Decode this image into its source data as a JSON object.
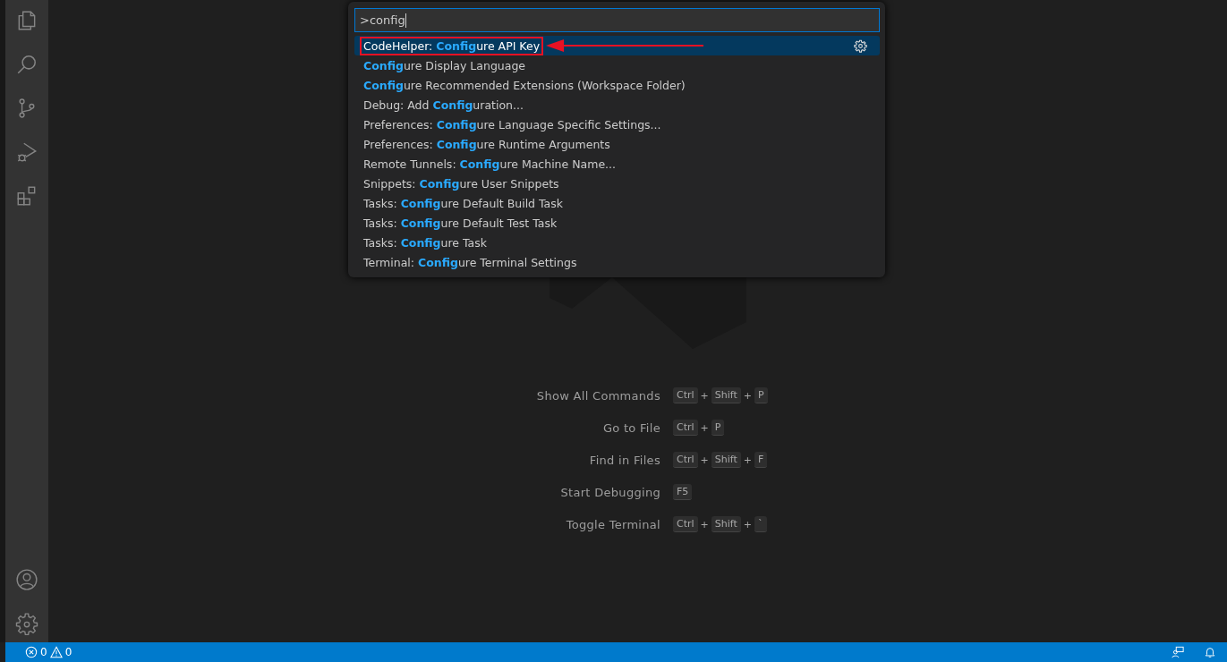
{
  "command_palette": {
    "query": ">config",
    "items": [
      {
        "label": "CodeHelper: **Config**ure API Key",
        "selected": true,
        "annotated": true
      },
      {
        "label": "**Config**ure Display Language",
        "selected": false,
        "annotated": false
      },
      {
        "label": "**Config**ure Recommended Extensions (Workspace Folder)",
        "selected": false,
        "annotated": false
      },
      {
        "label": "Debug: Add **Config**uration...",
        "selected": false,
        "annotated": false
      },
      {
        "label": "Preferences: **Config**ure Language Specific Settings...",
        "selected": false,
        "annotated": false
      },
      {
        "label": "Preferences: **Config**ure Runtime Arguments",
        "selected": false,
        "annotated": false
      },
      {
        "label": "Remote Tunnels: **Config**ure Machine Name...",
        "selected": false,
        "annotated": false
      },
      {
        "label": "Snippets: **Config**ure User Snippets",
        "selected": false,
        "annotated": false
      },
      {
        "label": "Tasks: **Config**ure Default Build Task",
        "selected": false,
        "annotated": false
      },
      {
        "label": "Tasks: **Config**ure Default Test Task",
        "selected": false,
        "annotated": false
      },
      {
        "label": "Tasks: **Config**ure Task",
        "selected": false,
        "annotated": false
      },
      {
        "label": "Terminal: **Config**ure Terminal Settings",
        "selected": false,
        "annotated": false
      }
    ]
  },
  "shortcuts": [
    {
      "label": "Show All Commands",
      "keys": [
        {
          "kind": "key",
          "text": "Ctrl"
        },
        {
          "kind": "plus",
          "text": "+"
        },
        {
          "kind": "key",
          "text": "Shift"
        },
        {
          "kind": "plus",
          "text": "+"
        },
        {
          "kind": "key",
          "text": "P"
        }
      ]
    },
    {
      "label": "Go to File",
      "keys": [
        {
          "kind": "key",
          "text": "Ctrl"
        },
        {
          "kind": "plus",
          "text": "+"
        },
        {
          "kind": "key",
          "text": "P"
        }
      ]
    },
    {
      "label": "Find in Files",
      "keys": [
        {
          "kind": "key",
          "text": "Ctrl"
        },
        {
          "kind": "plus",
          "text": "+"
        },
        {
          "kind": "key",
          "text": "Shift"
        },
        {
          "kind": "plus",
          "text": "+"
        },
        {
          "kind": "key",
          "text": "F"
        }
      ]
    },
    {
      "label": "Start Debugging",
      "keys": [
        {
          "kind": "key",
          "text": "F5"
        }
      ]
    },
    {
      "label": "Toggle Terminal",
      "keys": [
        {
          "kind": "key",
          "text": "Ctrl"
        },
        {
          "kind": "plus",
          "text": "+"
        },
        {
          "kind": "key",
          "text": "Shift"
        },
        {
          "kind": "plus",
          "text": "+"
        },
        {
          "kind": "key",
          "text": "`"
        }
      ]
    }
  ],
  "status_bar": {
    "errors": "0",
    "warnings": "0"
  }
}
